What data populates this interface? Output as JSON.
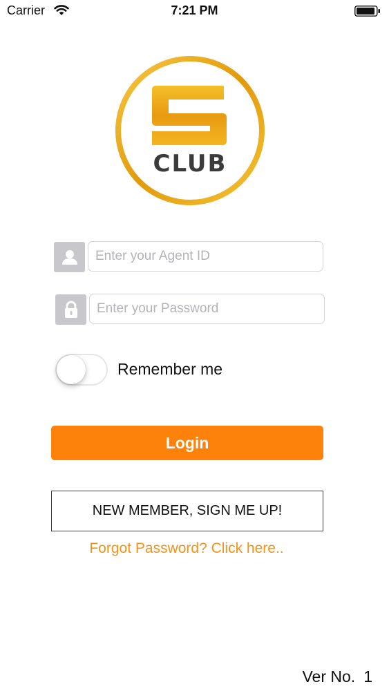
{
  "status_bar": {
    "carrier": "Carrier",
    "time": "7:21 PM",
    "icons": [
      "wifi-icon",
      "battery-icon"
    ]
  },
  "logo": {
    "brand_letter": "S",
    "brand_word": "CLUB",
    "ring_color": "#e5a814",
    "letter_color": "#f2b01a"
  },
  "form": {
    "agent_id": {
      "placeholder": "Enter your Agent ID",
      "value": "",
      "icon": "user-icon"
    },
    "password": {
      "placeholder": "Enter your Password",
      "value": "",
      "icon": "lock-icon"
    },
    "remember_me": {
      "label": "Remember me",
      "on": false
    }
  },
  "actions": {
    "login_label": "Login",
    "signup_label": "NEW MEMBER, SIGN ME UP!",
    "forgot_label": "Forgot Password? Click here.."
  },
  "footer": {
    "version_label": "Ver No.",
    "version_number": "1"
  },
  "colors": {
    "accent": "#fd820c",
    "link": "#f49319",
    "icon_box": "#c7c7cc"
  }
}
